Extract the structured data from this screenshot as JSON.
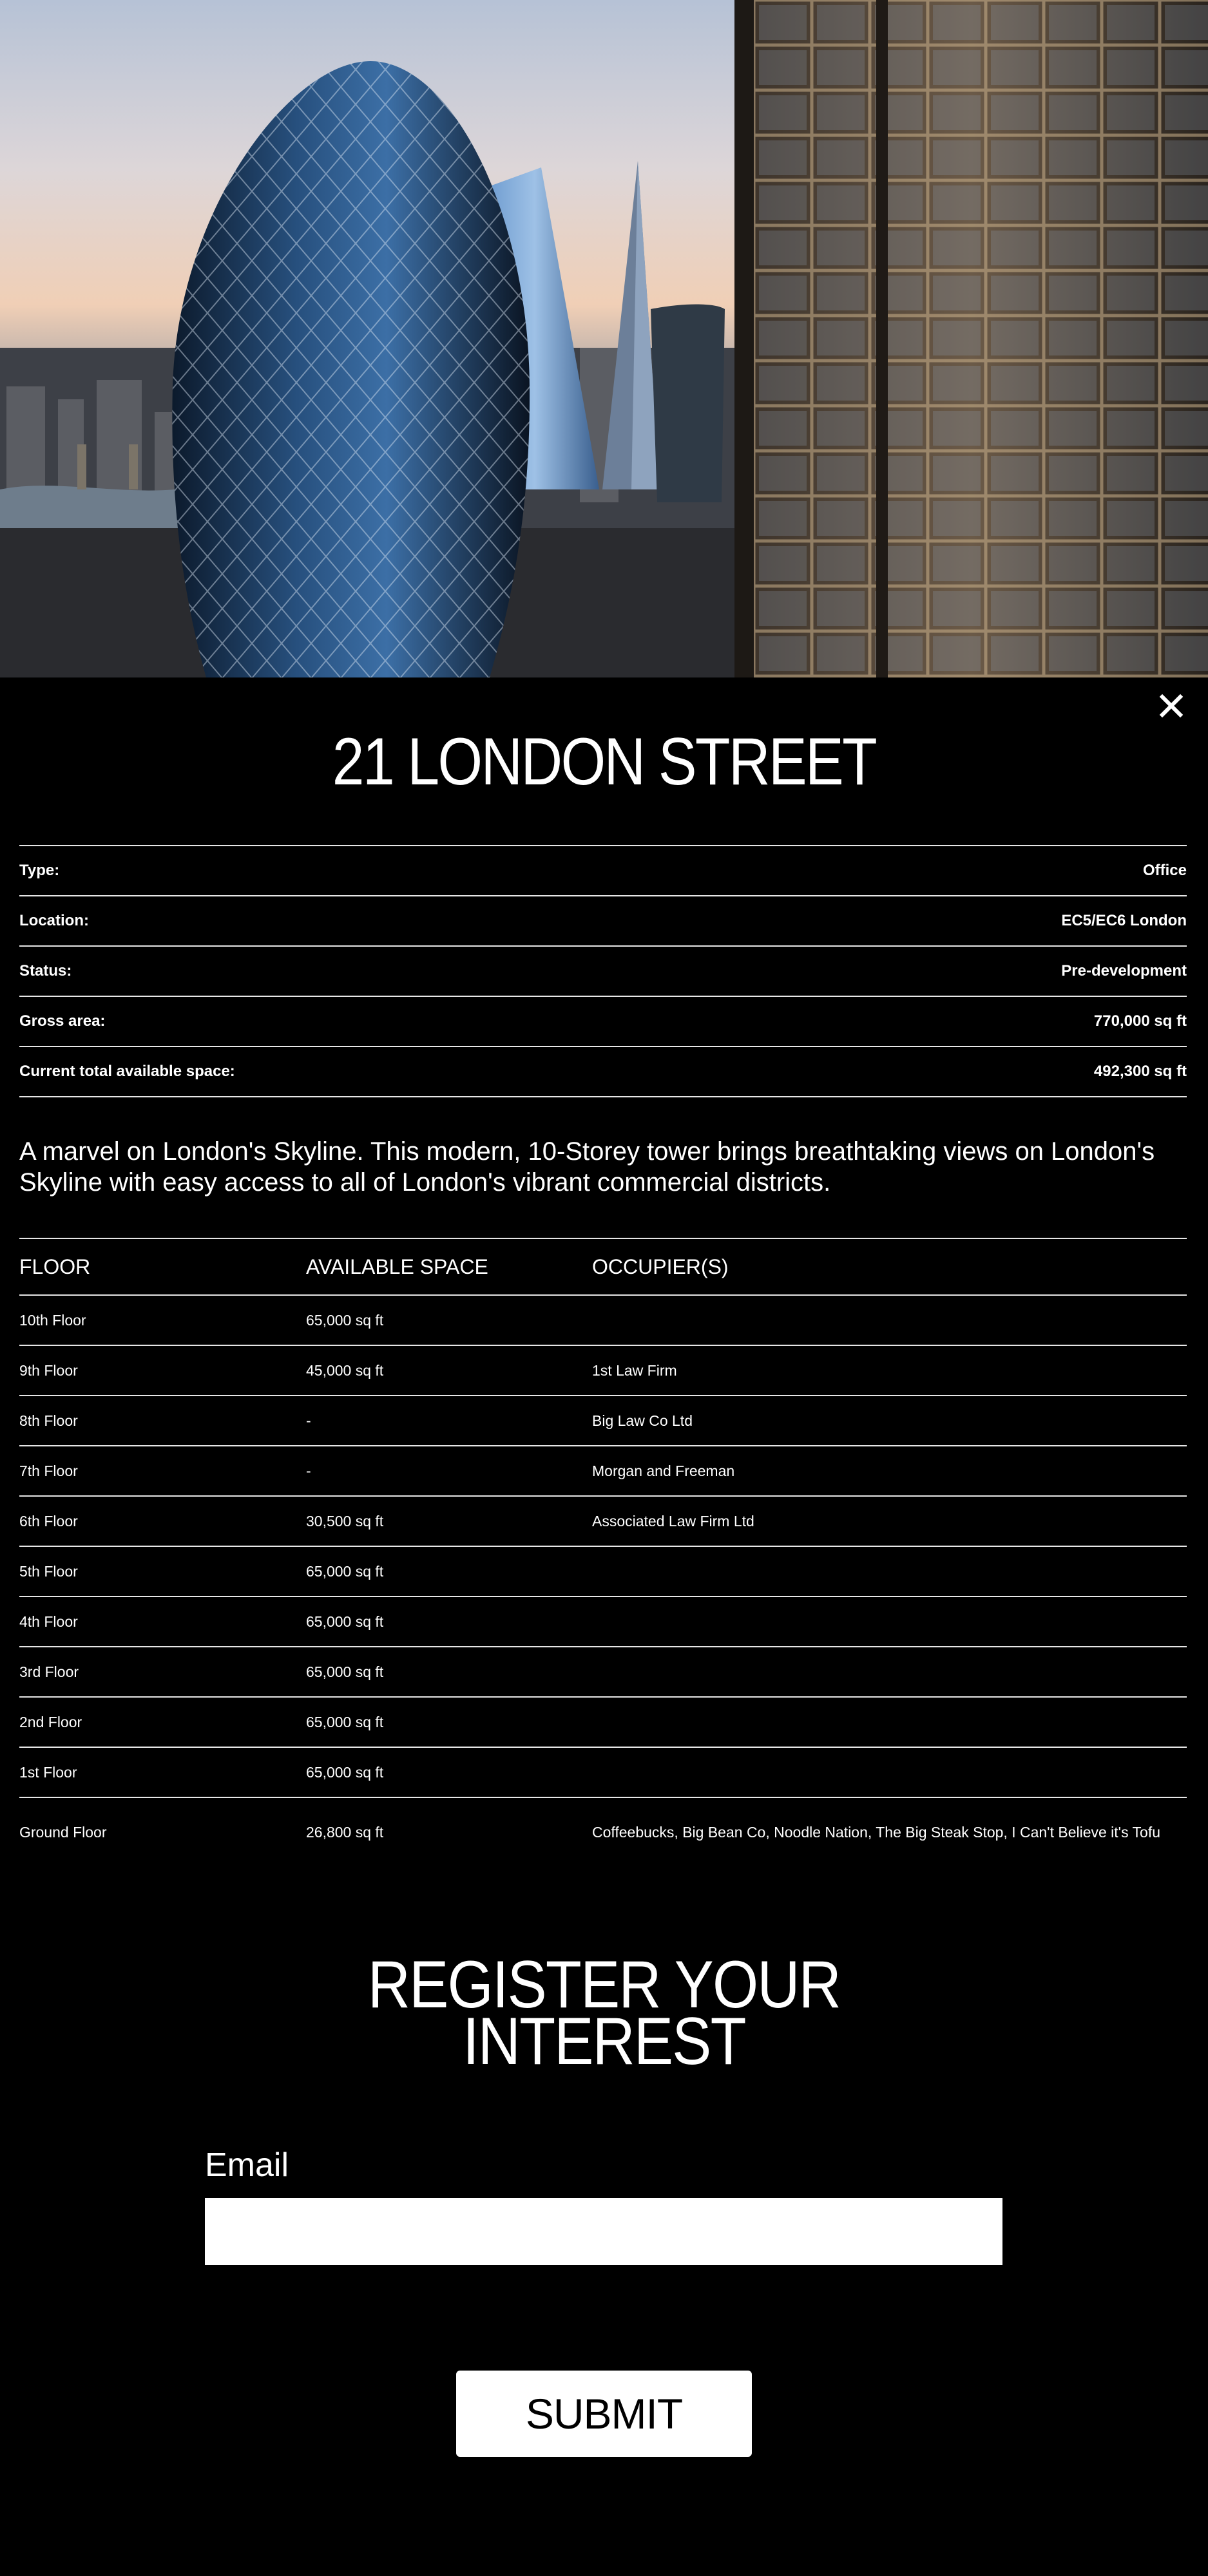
{
  "hero": {
    "image": "london-skyline-photo"
  },
  "close_icon": "close-icon",
  "property": {
    "title": "21 LONDON STREET",
    "details": [
      {
        "label": "Type:",
        "value": "Office"
      },
      {
        "label": "Location:",
        "value": "EC5/EC6 London"
      },
      {
        "label": "Status:",
        "value": "Pre-development"
      },
      {
        "label": "Gross area:",
        "value": "770,000 sq ft"
      },
      {
        "label": "Current total available space:",
        "value": "492,300 sq ft"
      }
    ],
    "description": "A marvel on London's Skyline. This modern, 10-Storey tower brings breathtaking views on London's Skyline with easy access to all of London's vibrant commercial districts."
  },
  "floors_table": {
    "headers": [
      "FLOOR",
      "AVAILABLE SPACE",
      "OCCUPIER(S)"
    ],
    "rows": [
      {
        "floor": "10th Floor",
        "space": "65,000 sq ft",
        "occupiers": ""
      },
      {
        "floor": "9th Floor",
        "space": "45,000 sq ft",
        "occupiers": "1st Law Firm"
      },
      {
        "floor": "8th Floor",
        "space": "-",
        "occupiers": "Big Law Co Ltd"
      },
      {
        "floor": "7th Floor",
        "space": "-",
        "occupiers": "Morgan and Freeman"
      },
      {
        "floor": "6th Floor",
        "space": "30,500 sq ft",
        "occupiers": "Associated Law Firm Ltd"
      },
      {
        "floor": "5th Floor",
        "space": "65,000 sq ft",
        "occupiers": ""
      },
      {
        "floor": "4th Floor",
        "space": "65,000 sq ft",
        "occupiers": ""
      },
      {
        "floor": "3rd Floor",
        "space": "65,000 sq ft",
        "occupiers": ""
      },
      {
        "floor": "2nd Floor",
        "space": "65,000 sq ft",
        "occupiers": ""
      },
      {
        "floor": "1st Floor",
        "space": "65,000 sq ft",
        "occupiers": ""
      },
      {
        "floor": "Ground Floor",
        "space": "26,800 sq ft",
        "occupiers": "Coffeebucks, Big Bean Co, Noodle Nation, The Big Steak Stop, I Can't Believe it's Tofu"
      }
    ]
  },
  "register": {
    "title_line1": "REGISTER YOUR",
    "title_line2": "INTEREST",
    "email_label": "Email",
    "email_value": "",
    "submit_label": "SUBMIT"
  }
}
